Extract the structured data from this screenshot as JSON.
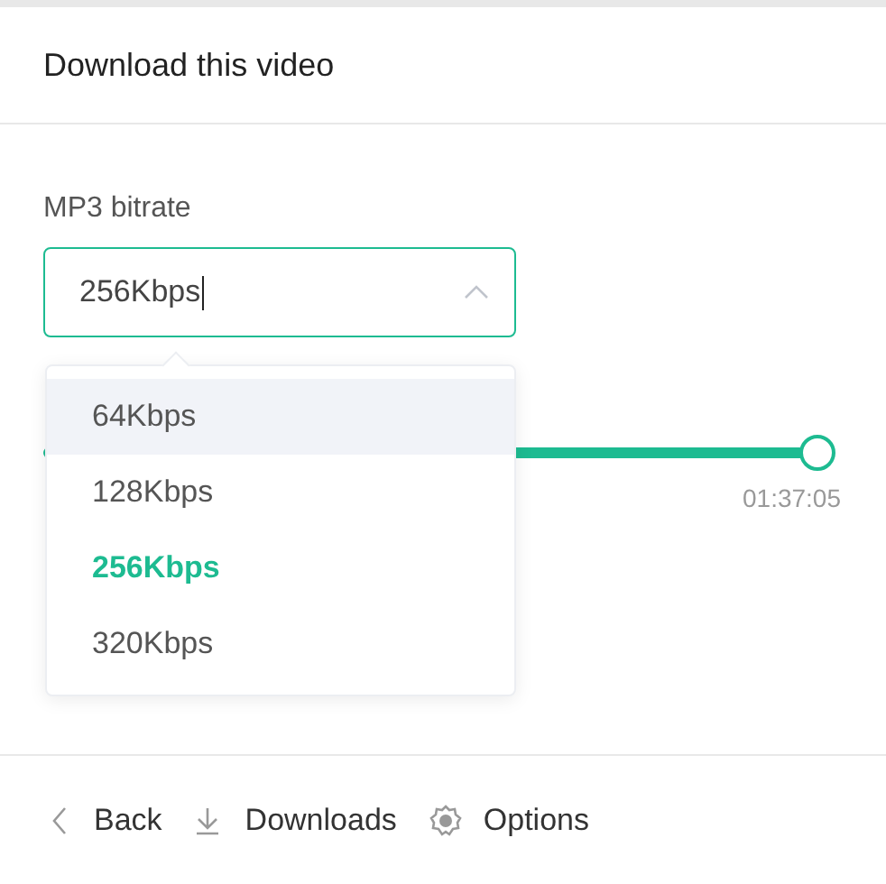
{
  "dialog": {
    "title": "Download this video"
  },
  "bitrate": {
    "label": "MP3 bitrate",
    "value": "256Kbps",
    "expanded": true,
    "options": [
      {
        "label": "64Kbps",
        "selected": false,
        "hovered": true
      },
      {
        "label": "128Kbps",
        "selected": false,
        "hovered": false
      },
      {
        "label": "256Kbps",
        "selected": true,
        "hovered": false
      },
      {
        "label": "320Kbps",
        "selected": false,
        "hovered": false
      }
    ]
  },
  "range": {
    "level": 1,
    "end_time": "01:37:05"
  },
  "footer": [
    {
      "kind": "back",
      "label": "Back"
    },
    {
      "kind": "downloads",
      "label": "Downloads"
    },
    {
      "kind": "options",
      "label": "Options"
    }
  ]
}
